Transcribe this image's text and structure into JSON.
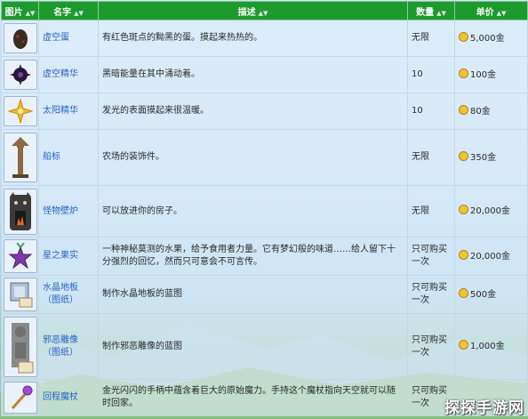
{
  "headers": {
    "image": "图片",
    "name": "名字",
    "desc": "描述",
    "qty": "数量",
    "price": "单价"
  },
  "rows": [
    {
      "name": "虚空蛋",
      "desc": "有红色斑点的黝黑的蛋。摸起来热热的。",
      "qty": "无限",
      "price": "5,000金",
      "icon": "void-egg-icon"
    },
    {
      "name": "虚空精华",
      "desc": "黑暗能量在其中涌动着。",
      "qty": "10",
      "price": "100金",
      "icon": "void-essence-icon"
    },
    {
      "name": "太阳精华",
      "desc": "发光的表面摸起来很温暖。",
      "qty": "10",
      "price": "80金",
      "icon": "solar-essence-icon"
    },
    {
      "name": "船标",
      "desc": "农场的装饰件。",
      "qty": "无限",
      "price": "350金",
      "icon": "signpost-icon"
    },
    {
      "name": "怪物壁炉",
      "desc": "可以放进你的房子。",
      "qty": "无限",
      "price": "20,000金",
      "icon": "monster-fireplace-icon"
    },
    {
      "name": "星之果实",
      "desc": "一种神秘莫测的水果，给予食用者力量。它有梦幻般的味道……给人留下十分强烈的回忆，然而只可意会不可言传。",
      "qty": "只可购买一次",
      "price": "20,000金",
      "icon": "stardrop-icon"
    },
    {
      "name": "水晶地板（图纸）",
      "desc": "制作水晶地板的蓝图",
      "qty": "只可购买一次",
      "price": "500金",
      "icon": "crystal-floor-recipe-icon"
    },
    {
      "name": "邪恶雕像（图纸）",
      "desc": "制作邪恶雕像的蓝图",
      "qty": "只可购买一次",
      "price": "1,000金",
      "icon": "wicked-statue-recipe-icon"
    },
    {
      "name": "回程魔杖",
      "desc": "金光闪闪的手柄中蕴含着巨大的原始魔力。手持这个魔杖指向天空就可以随时回家。",
      "qty": "只可购买一次",
      "price": "",
      "icon": "return-scepter-icon"
    }
  ],
  "watermark": "探探手游网"
}
